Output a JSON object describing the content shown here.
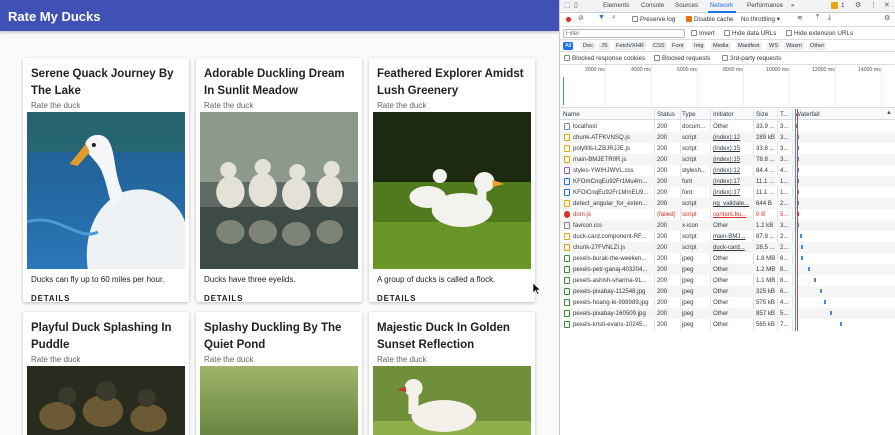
{
  "app": {
    "title": "Rate My Ducks",
    "cards": [
      {
        "title": "Serene Quack Journey By The Lake",
        "subtitle": "Rate the duck",
        "fact": "Ducks can fly up to 60 miles per hour.",
        "button": "DETAILS"
      },
      {
        "title": "Adorable Duckling Dream In Sunlit Meadow",
        "subtitle": "Rate the duck",
        "fact": "Ducks have three eyelids.",
        "button": "DETAILS"
      },
      {
        "title": "Feathered Explorer Amidst Lush Greenery",
        "subtitle": "Rate the duck",
        "fact": "A group of ducks is called a flock.",
        "button": "DETAILS"
      },
      {
        "title": "Playful Duck Splashing In Puddle",
        "subtitle": "Rate the duck"
      },
      {
        "title": "Splashy Duckling By The Quiet Pond",
        "subtitle": "Rate the duck"
      },
      {
        "title": "Majestic Duck In Golden Sunset Reflection",
        "subtitle": "Rate the duck"
      }
    ]
  },
  "devtools": {
    "tabs": [
      "Elements",
      "Console",
      "Sources",
      "Network",
      "Performance",
      "»"
    ],
    "active_tab": "Network",
    "issue_count": "1",
    "toolbar": {
      "preserve_log": "Preserve log",
      "disable_cache": "Disable cache",
      "throttling": "No throttling"
    },
    "filter": {
      "placeholder": "Filter",
      "invert": "Invert",
      "hide_data_urls": "Hide data URLs",
      "hide_extension_urls": "Hide extension URLs"
    },
    "type_filters": [
      "All",
      "Doc",
      "JS",
      "Fetch/XHR",
      "CSS",
      "Font",
      "Img",
      "Media",
      "Manifest",
      "WS",
      "Wasm",
      "Other"
    ],
    "blocked": {
      "cookies": "Blocked response cookies",
      "requests": "Blocked requests",
      "third_party": "3rd-party requests"
    },
    "timeline_ticks": [
      "2000 ms",
      "4000 ms",
      "6000 ms",
      "8000 ms",
      "10000 ms",
      "12000 ms",
      "14000 ms"
    ],
    "columns": {
      "name": "Name",
      "status": "Status",
      "type": "Type",
      "initiator": "Initiator",
      "size": "Size",
      "time": "T...",
      "waterfall": "Waterfall"
    },
    "requests": [
      {
        "name": "localhost",
        "status": "200",
        "type": "docum...",
        "initiator": "Other",
        "size": "33.9 ...",
        "time": "3...",
        "wf": 0
      },
      {
        "name": "chunk-ATFKVNSQ.js",
        "status": "200",
        "type": "script",
        "initiator": "(index):12",
        "size": "289 kB",
        "time": "3...",
        "wf": 1
      },
      {
        "name": "polyfills-LZBJRJJE.js",
        "status": "200",
        "type": "script",
        "initiator": "(index):15",
        "size": "33.8 ...",
        "time": "3...",
        "wf": 1
      },
      {
        "name": "main-BMJETR0R.js",
        "status": "200",
        "type": "script",
        "initiator": "(index):15",
        "size": "78.8 ...",
        "time": "3...",
        "wf": 1
      },
      {
        "name": "styles-YWIHJWVL.css",
        "status": "200",
        "type": "stylesh...",
        "initiator": "(index):12",
        "size": "84.4 ...",
        "time": "4...",
        "wf": 1
      },
      {
        "name": "KFOmCnqEu92Fr1Mu4m...",
        "status": "200",
        "type": "font",
        "initiator": "(index):17",
        "size": "11.1 ...",
        "time": "1...",
        "wf": 1
      },
      {
        "name": "KFOlCnqEu92Fr1MmEU9...",
        "status": "200",
        "type": "font",
        "initiator": "(index):17",
        "size": "11.1 ...",
        "time": "1...",
        "wf": 1
      },
      {
        "name": "detect_angular_for_exten...",
        "status": "200",
        "type": "script",
        "initiator": "ng_validate...",
        "size": "644 B",
        "time": "2...",
        "wf": 1
      },
      {
        "name": "dom.js",
        "status": "(failed)",
        "type": "script",
        "initiator": "content.bu...",
        "size": "0 B",
        "time": "5...",
        "wf": 1,
        "error": true
      },
      {
        "name": "favicon.ico",
        "status": "200",
        "type": "x-icon",
        "initiator": "Other",
        "size": "1.2 kB",
        "time": "3...",
        "wf": 1
      },
      {
        "name": "duck-card.component-RF...",
        "status": "200",
        "type": "script",
        "initiator": "main-BMJ...",
        "size": "87.9 ...",
        "time": "2...",
        "wf": 4
      },
      {
        "name": "chunk-27FVNLZI.js",
        "status": "200",
        "type": "script",
        "initiator": "duck-card...",
        "size": "28.5 ...",
        "time": "2...",
        "wf": 5
      },
      {
        "name": "pexels-burak-the-weeken...",
        "status": "200",
        "type": "jpeg",
        "initiator": "Other",
        "size": "1.8 MB",
        "time": "6...",
        "wf": 5
      },
      {
        "name": "pexels-petr-ganaj-403204...",
        "status": "200",
        "type": "jpeg",
        "initiator": "Other",
        "size": "1.2 MB",
        "time": "8...",
        "wf": 12
      },
      {
        "name": "pexels-ashish-sharma-91...",
        "status": "200",
        "type": "jpeg",
        "initiator": "Other",
        "size": "1.1 MB",
        "time": "8...",
        "wf": 18
      },
      {
        "name": "pexels-pixabay-112548.jpg",
        "status": "200",
        "type": "jpeg",
        "initiator": "Other",
        "size": "325 kB",
        "time": "6...",
        "wf": 24
      },
      {
        "name": "pexels-hoang-le-998989.jpg",
        "status": "200",
        "type": "jpeg",
        "initiator": "Other",
        "size": "575 kB",
        "time": "4...",
        "wf": 28
      },
      {
        "name": "pexels-pixabay-160509.jpg",
        "status": "200",
        "type": "jpeg",
        "initiator": "Other",
        "size": "857 kB",
        "time": "5...",
        "wf": 34
      },
      {
        "name": "pexels-kristi-evans-10245...",
        "status": "200",
        "type": "jpeg",
        "initiator": "Other",
        "size": "565 kB",
        "time": "7...",
        "wf": 44
      }
    ]
  }
}
